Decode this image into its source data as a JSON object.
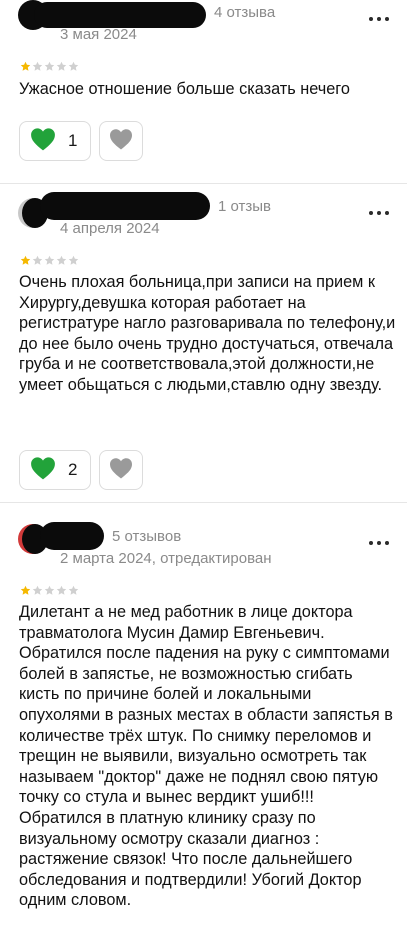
{
  "reviews": [
    {
      "review_count": "4 отзыва",
      "date": "3 мая 2024",
      "rating": 1,
      "max_rating": 5,
      "text": "Ужасное отношение больше сказать нечего",
      "likes": "1"
    },
    {
      "review_count": "1 отзыв",
      "date": "4 апреля 2024",
      "rating": 1,
      "max_rating": 5,
      "text": "Очень плохая больница,при записи на прием к Хирургу,девушка которая работает на регистратуре нагло разговаривала по телефону,и до нее было очень трудно достучаться, отвечала груба и не соответствовала,этой должности,не умеет обьщаться с людьми,ставлю одну звезду.",
      "likes": "2"
    },
    {
      "review_count": "5 отзывов",
      "date": "2 марта 2024, отредактирован",
      "rating": 1,
      "max_rating": 5,
      "text": "Дилетант а не мед работник в лице доктора травматолога Мусин Дамир Евгеньевич. Обратился после падения на руку с симптомами болей в запястье, не возможностью сгибать кисть по причине болей и локальными опухолями в разных местах в области запястья в количестве трёх штук. По снимку переломов и трещин не выявили, визуально осмотреть так называем \"доктор\" даже не поднял свою пятую точку со стула и вынес вердикт ушиб!!! Обратился в платную клинику сразу по визуальному осмотру сказали диагноз : растяжение связок! Что после дальнейшего обследования и подтвердили! Убогий Доктор одним словом."
    }
  ],
  "icons": {
    "more": "more-dots-icon",
    "like": "green-heart-icon",
    "dislike": "gray-heart-icon",
    "star": "star-icon"
  },
  "colors": {
    "star_filled": "#f5b800",
    "star_empty": "#d0d0d0",
    "like_heart": "#22a33a",
    "dislike_heart": "#9a9a9a",
    "meta_text": "#8a8a8a"
  }
}
